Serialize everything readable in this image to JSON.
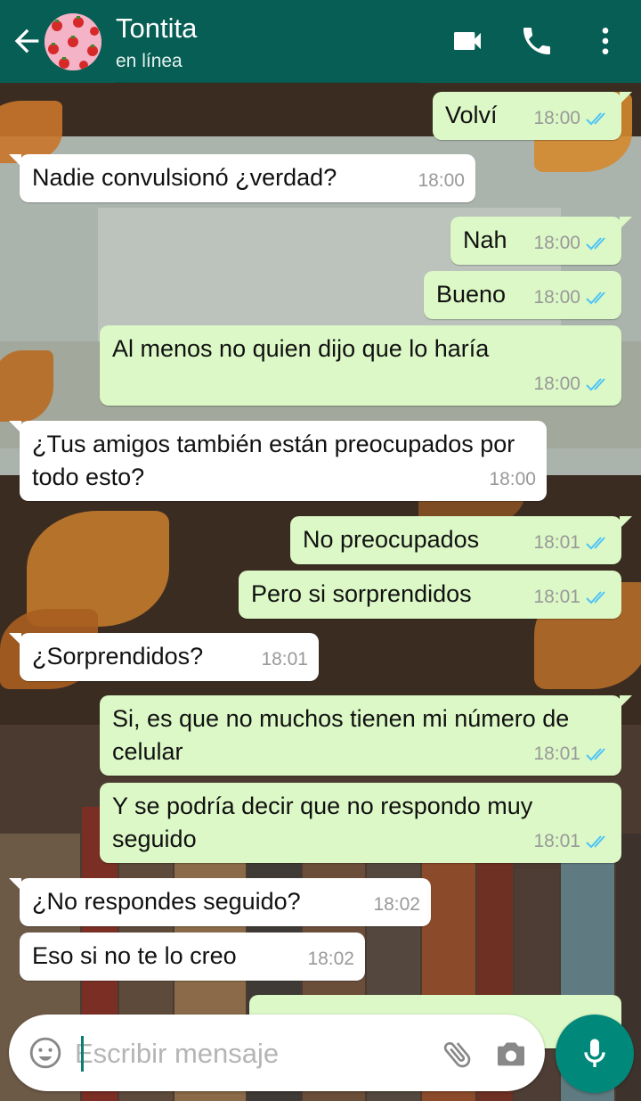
{
  "header": {
    "title": "Tontita",
    "subtitle": "en línea"
  },
  "messages": [
    {
      "dir": "out",
      "text": "Volví",
      "time": "18:00",
      "ticks": "read"
    },
    {
      "dir": "in",
      "text": "Nadie convulsionó ¿verdad?",
      "time": "18:00"
    },
    {
      "dir": "out",
      "text": "Nah",
      "time": "18:00",
      "ticks": "read"
    },
    {
      "dir": "out",
      "text": "Bueno",
      "time": "18:00",
      "ticks": "read"
    },
    {
      "dir": "out",
      "text": "Al menos no quien dijo que lo haría",
      "time": "18:00",
      "ticks": "read"
    },
    {
      "dir": "in",
      "text": "¿Tus amigos también están preocupados por todo esto?",
      "time": "18:00"
    },
    {
      "dir": "out",
      "text": "No preocupados",
      "time": "18:01",
      "ticks": "read"
    },
    {
      "dir": "out",
      "text": "Pero si sorprendidos",
      "time": "18:01",
      "ticks": "read"
    },
    {
      "dir": "in",
      "text": "¿Sorprendidos?",
      "time": "18:01"
    },
    {
      "dir": "out",
      "text": "Si, es que no muchos tienen mi número de celular",
      "time": "18:01",
      "ticks": "read"
    },
    {
      "dir": "out",
      "text": "Y se podría decir que no respondo muy seguido",
      "time": "18:01",
      "ticks": "read"
    },
    {
      "dir": "in",
      "text": "¿No respondes seguido?",
      "time": "18:02"
    },
    {
      "dir": "in",
      "text": "Eso si no te lo creo",
      "time": "18:02"
    }
  ],
  "composer": {
    "placeholder": "Escribir mensaje"
  },
  "colors": {
    "header": "#075E54",
    "outgoing_bubble": "#DCF8C6",
    "incoming_bubble": "#FFFFFF",
    "read_ticks": "#4FC3F7",
    "mic_button": "#00897B"
  },
  "icons": [
    "back-arrow-icon",
    "video-call-icon",
    "phone-icon",
    "more-vert-icon",
    "emoji-icon",
    "attach-icon",
    "camera-icon",
    "mic-icon",
    "double-check-icon"
  ]
}
